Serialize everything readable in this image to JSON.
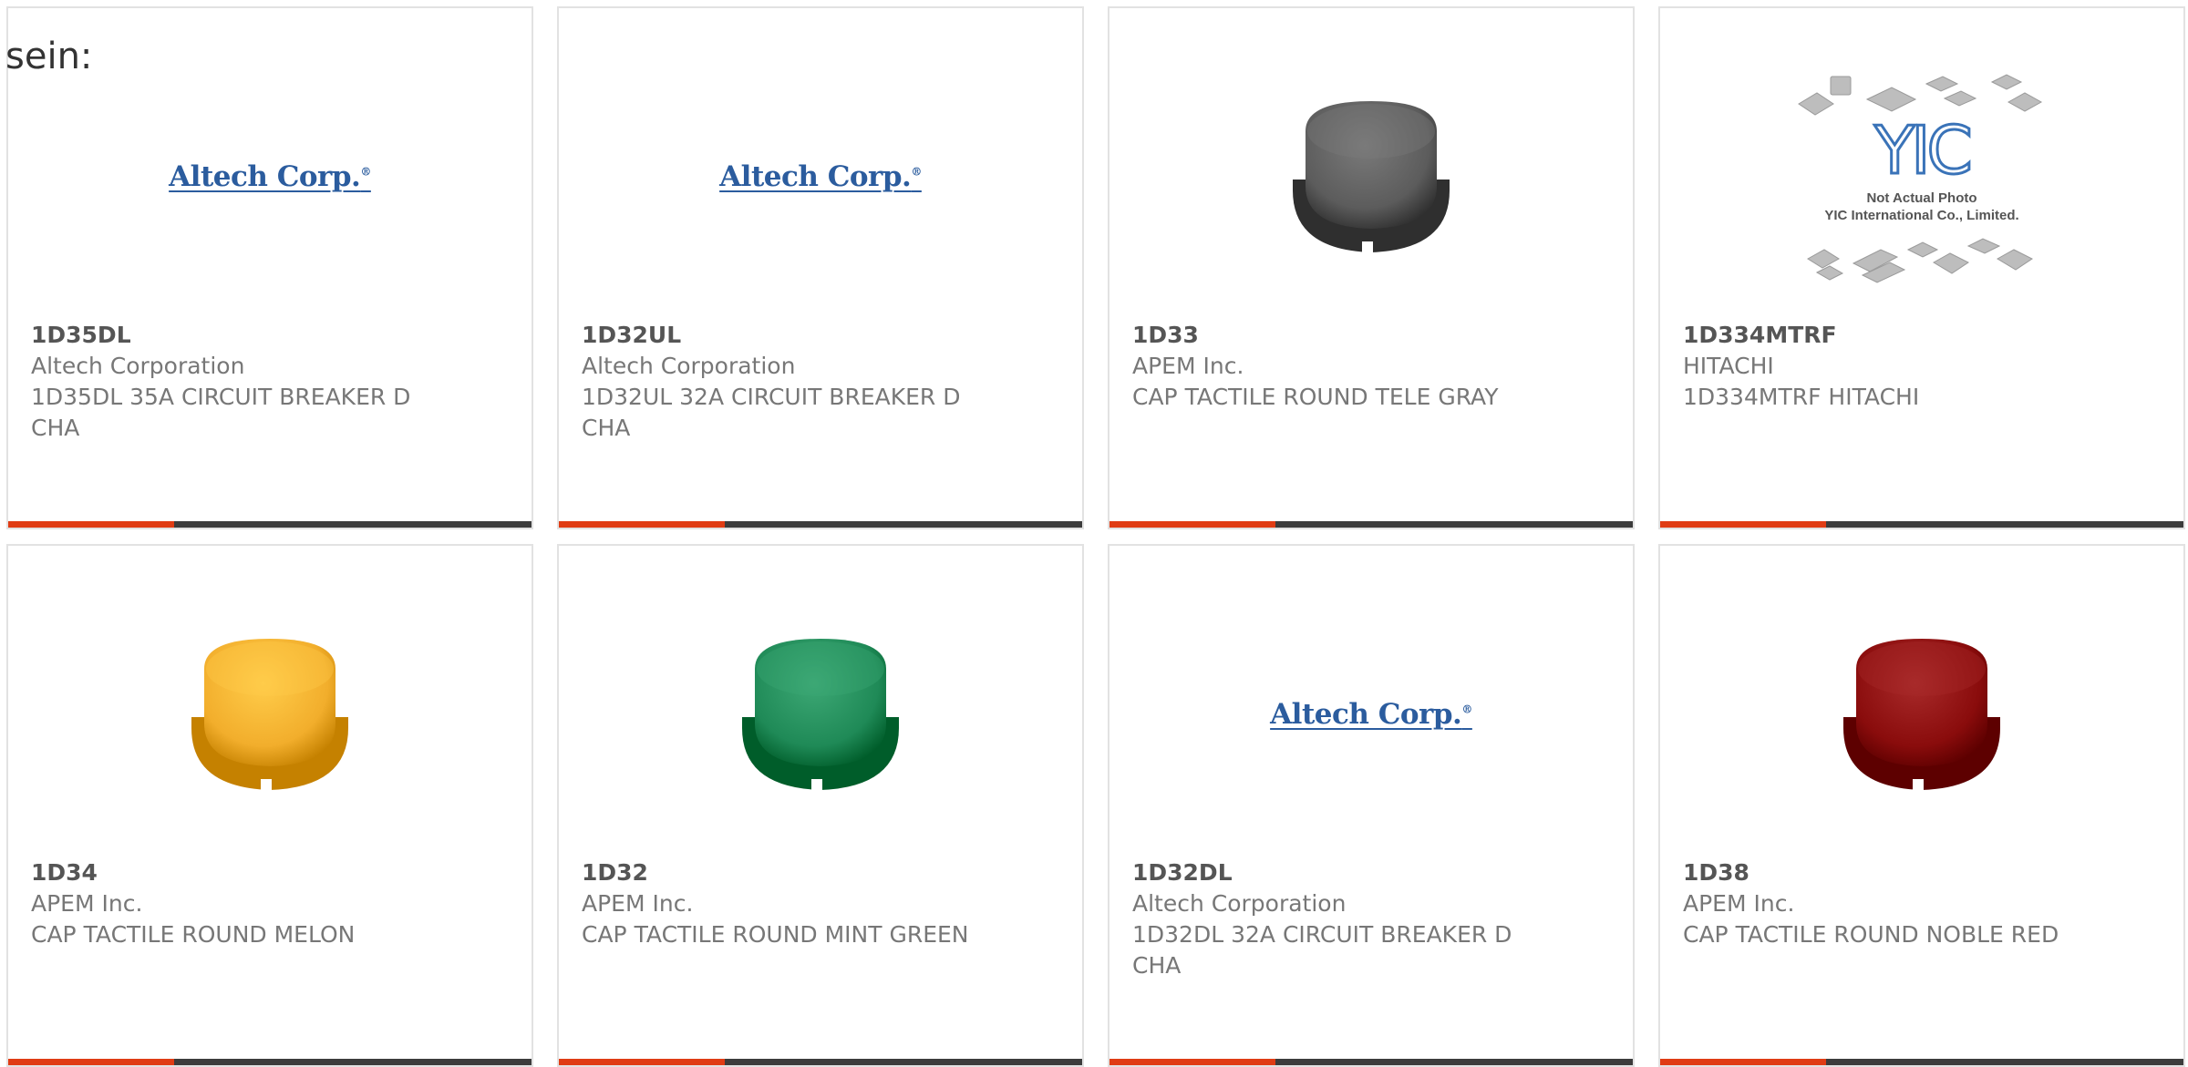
{
  "intro_text": "sein:",
  "colors": {
    "accent": "#e03c14",
    "bar": "#3c3c3c",
    "altech_logo": "#2b5c9e",
    "yic_logo": "#3a73b8"
  },
  "products": [
    {
      "part_number": "1D35DL",
      "manufacturer": "Altech Corporation",
      "description": "1D35DL 35A CIRCUIT BREAKER D CHA",
      "image": {
        "kind": "altech-logo",
        "logo_text": "Altech Corp."
      }
    },
    {
      "part_number": "1D32UL",
      "manufacturer": "Altech Corporation",
      "description": "1D32UL 32A CIRCUIT BREAKER D CHA",
      "image": {
        "kind": "altech-logo",
        "logo_text": "Altech Corp."
      }
    },
    {
      "part_number": "1D33",
      "manufacturer": "APEM Inc.",
      "description": "CAP TACTILE ROUND TELE GRAY",
      "image": {
        "kind": "round-cap",
        "color": "#5c5c5c"
      }
    },
    {
      "part_number": "1D334MTRF",
      "manufacturer": "HITACHI",
      "description": "1D334MTRF HITACHI",
      "image": {
        "kind": "yic-placeholder",
        "logo_text": "YIC",
        "caption_line1": "Not Actual Photo",
        "caption_line2": "YIC International Co., Limited."
      }
    },
    {
      "part_number": "1D34",
      "manufacturer": "APEM Inc.",
      "description": "CAP TACTILE ROUND MELON",
      "image": {
        "kind": "round-cap",
        "color": "#f2ae2c"
      }
    },
    {
      "part_number": "1D32",
      "manufacturer": "APEM Inc.",
      "description": "CAP TACTILE ROUND MINT GREEN",
      "image": {
        "kind": "round-cap",
        "color": "#1f8a57"
      }
    },
    {
      "part_number": "1D32DL",
      "manufacturer": "Altech Corporation",
      "description": "1D32DL 32A CIRCUIT BREAKER D CHA",
      "image": {
        "kind": "altech-logo",
        "logo_text": "Altech Corp."
      }
    },
    {
      "part_number": "1D38",
      "manufacturer": "APEM Inc.",
      "description": "CAP TACTILE ROUND NOBLE RED",
      "image": {
        "kind": "round-cap",
        "color": "#8a0c0c"
      }
    }
  ]
}
